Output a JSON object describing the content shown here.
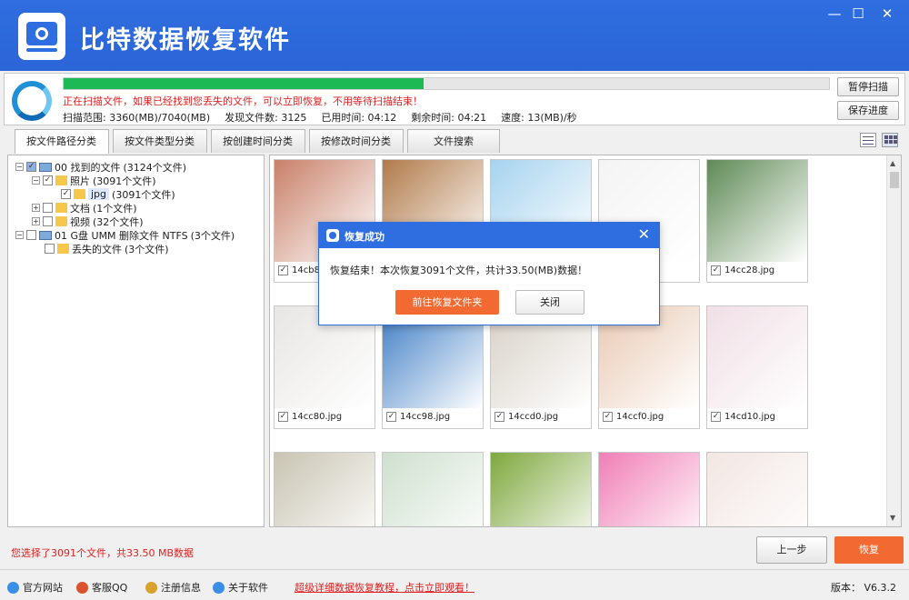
{
  "app": {
    "title": "比特数据恢复软件",
    "min_glyph": "—",
    "max_glyph": "☐",
    "close_glyph": "✕"
  },
  "scan": {
    "progress": 0.47,
    "message": "正在扫描文件，如果已经找到您丢失的文件，可以立即恢复，不用等待扫描结束！",
    "range": "扫描范围: 3360(MB)/7040(MB)",
    "found": "发现文件数: 3125",
    "elapsed": "已用时间: 04:12",
    "remaining": "剩余时间: 04:21",
    "speed": "速度: 13(MB)/秒",
    "pause_label": "暂停扫描",
    "save_label": "保存进度"
  },
  "tabs": [
    {
      "label": "按文件路径分类"
    },
    {
      "label": "按文件类型分类"
    },
    {
      "label": "按创建时间分类"
    },
    {
      "label": "按修改时间分类"
    },
    {
      "label": "文件搜索"
    }
  ],
  "tree": [
    {
      "name": "00 找到的文件",
      "count": "(3124个文件)"
    },
    {
      "name": "照片",
      "count": "(3091个文件)"
    },
    {
      "name": "jpg",
      "count": "(3091个文件)"
    },
    {
      "name": "文档",
      "count": "(1个文件)"
    },
    {
      "name": "视频",
      "count": "(32个文件)"
    },
    {
      "name": "01 G盘 UMM 删除文件 NTFS",
      "count": "(3个文件)"
    },
    {
      "name": "丢失的文件",
      "count": "(3个文件)"
    }
  ],
  "files": [
    {
      "name": "14cb88.jpg",
      "color": "#c8806a"
    },
    {
      "name": "",
      "color": "#b07a4a"
    },
    {
      "name": "",
      "color": "#a7d3ef"
    },
    {
      "name": "",
      "color": "#f4f4f4"
    },
    {
      "name": "14cc28.jpg",
      "color": "#5f8a56"
    },
    {
      "name": "14cc80.jpg",
      "color": "#e8e6e4"
    },
    {
      "name": "14cc98.jpg",
      "color": "#3f7dc4"
    },
    {
      "name": "14ccd0.jpg",
      "color": "#d7d0c6"
    },
    {
      "name": "14ccf0.jpg",
      "color": "#e9c9b3"
    },
    {
      "name": "14cd10.jpg",
      "color": "#f0dfe6"
    },
    {
      "name": "",
      "color": "#c9c4b2"
    },
    {
      "name": "",
      "color": "#cfe0cf"
    },
    {
      "name": "",
      "color": "#7ea83e"
    },
    {
      "name": "",
      "color": "#f07fb6"
    },
    {
      "name": "",
      "color": "#f2e6e2"
    }
  ],
  "dialog": {
    "title": "恢复成功",
    "message": "恢复结束！本次恢复3091个文件，共计33.50(MB)数据！",
    "open_label": "前往恢复文件夹",
    "close_label": "关闭",
    "close_glyph": "✕"
  },
  "bottom": {
    "selection": "您选择了3091个文件，共33.50 MB数据",
    "back_label": "上一步",
    "recover_label": "恢复"
  },
  "footer": {
    "links": [
      {
        "label": "官方网站",
        "icon": "globe-icon",
        "color": "#3a8ee6"
      },
      {
        "label": "客服QQ",
        "icon": "qq-icon",
        "color": "#d9532c"
      },
      {
        "label": "注册信息",
        "icon": "key-icon",
        "color": "#d9a22c"
      },
      {
        "label": "关于软件",
        "icon": "info-icon",
        "color": "#3a8ee6"
      }
    ],
    "promo": "超级详细数据恢复教程，点击立即观看！",
    "version": "版本： V6.3.2"
  },
  "colors": {
    "accent": "#2f6ee0",
    "action": "#f26a32",
    "progress": "#1db954",
    "alert_text": "#e02020"
  }
}
